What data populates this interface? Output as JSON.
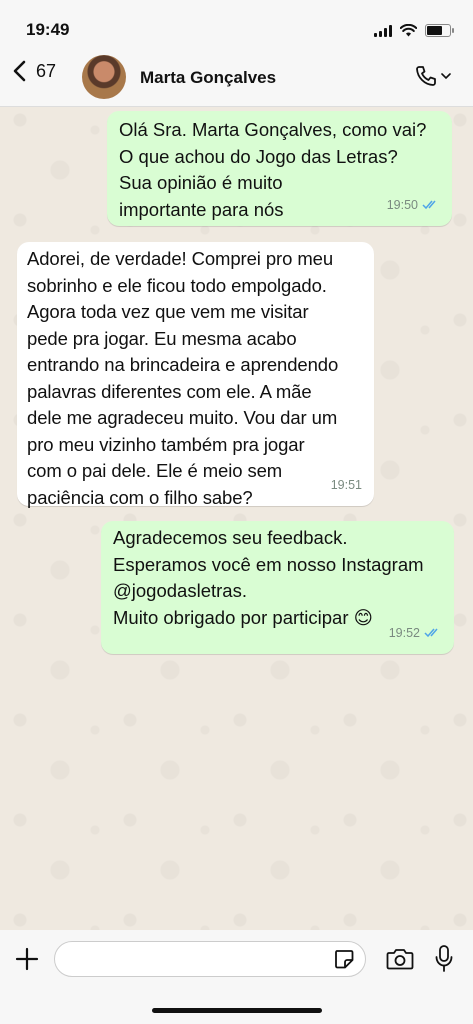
{
  "status_bar": {
    "time": "19:49"
  },
  "header": {
    "back_count": "67",
    "contact_name": "Marta Gonçalves"
  },
  "messages": [
    {
      "direction": "outgoing",
      "text": "Olá Sra. Marta Gonçalves, como vai?\nO que achou do Jogo das Letras?\nSua opinião é muito\nimportante para nós",
      "time": "19:50",
      "status": "read"
    },
    {
      "direction": "incoming",
      "text": "Adorei, de verdade! Comprei pro meu\nsobrinho e ele ficou todo empolgado.\nAgora toda vez que vem me visitar\npede pra jogar. Eu mesma acabo\nentrando na brincadeira e aprendendo\npalavras diferentes com ele. A mãe\ndele me agradeceu muito. Vou dar um\npro meu vizinho também pra jogar\ncom o pai dele. Ele é meio sem\npaciência com o filho sabe?",
      "time": "19:51"
    },
    {
      "direction": "outgoing",
      "text": "Agradecemos seu feedback.\nEsperamos você em nosso Instagram\n@jogodasletras.\nMuito obrigado por participar 😊",
      "time": "19:52",
      "status": "read"
    }
  ],
  "composer": {
    "placeholder": ""
  },
  "icons": {
    "back": "chevron-left-icon",
    "call": "phone-icon",
    "attach": "plus-icon",
    "sticker": "sticker-icon",
    "camera": "camera-icon",
    "mic": "microphone-icon",
    "read_receipt": "double-check-icon"
  },
  "colors": {
    "outgoing_bubble": "#d9fdd3",
    "incoming_bubble": "#ffffff",
    "read_ticks": "#4fa4e8"
  }
}
